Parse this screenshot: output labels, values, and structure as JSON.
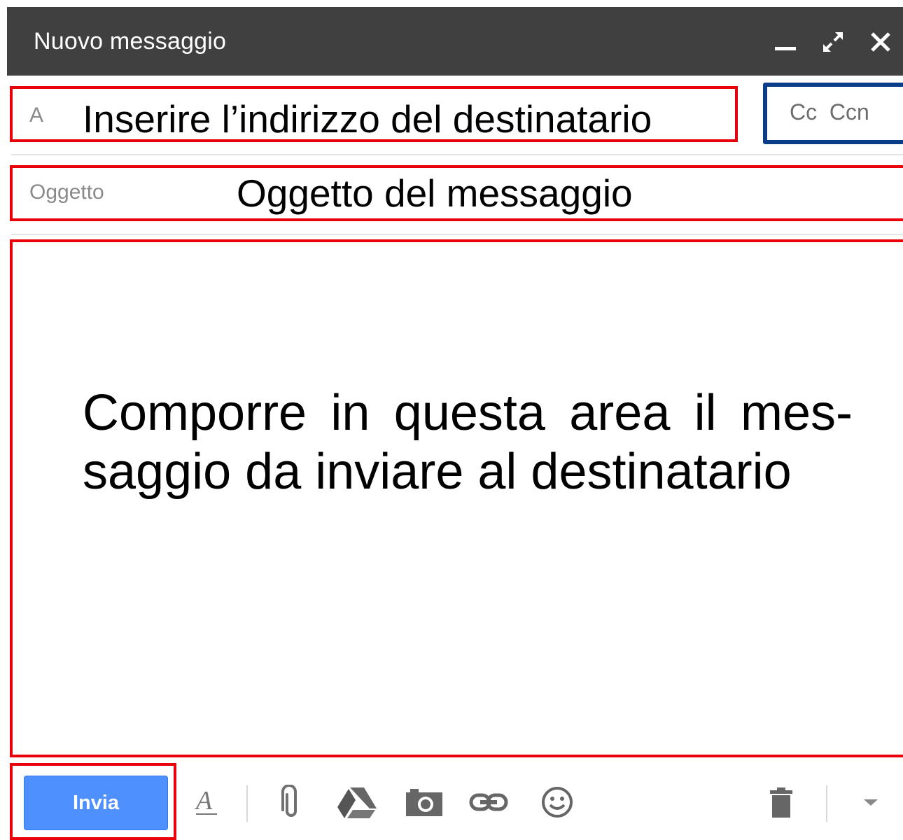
{
  "window": {
    "title": "Nuovo messaggio"
  },
  "compose": {
    "to_label": "A",
    "cc_bcc_label": "Cc  Ccn",
    "subject_label": "Oggetto",
    "send_label": "Invia"
  },
  "annotations": {
    "to_note": "Inserire l’indirizzo del destinatario",
    "subject_note": "Oggetto del messaggio",
    "body_note": "Comporre in questa area il mes-saggio da inviare al destinatario"
  },
  "toolbar": {
    "icons": [
      "formatting-icon",
      "attach-icon",
      "drive-icon",
      "photo-icon",
      "link-icon",
      "emoji-icon",
      "trash-icon",
      "more-options-icon"
    ]
  },
  "colors": {
    "title_bar": "#404040",
    "send_button": "#4d90fe",
    "annotation_red": "#e8000b",
    "annotation_blue": "#0a3d87"
  }
}
